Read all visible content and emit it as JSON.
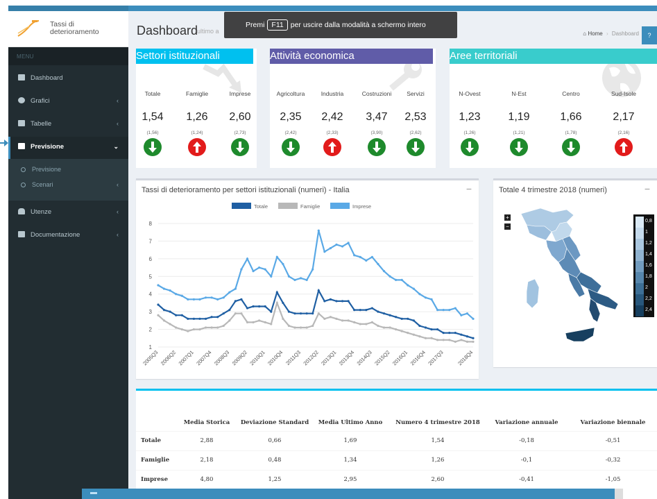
{
  "app": {
    "logo_text": "Tassi di deterioramento",
    "menu_header": "MENU"
  },
  "sidebar": {
    "items": [
      {
        "label": "Dashboard",
        "icon": "dashboard-icon"
      },
      {
        "label": "Grafici",
        "icon": "pie-chart-icon"
      },
      {
        "label": "Tabelle",
        "icon": "table-icon"
      },
      {
        "label": "Previsione",
        "icon": "bar-chart-icon"
      },
      {
        "label": "Utenze",
        "icon": "user-icon"
      },
      {
        "label": "Documentazione",
        "icon": "book-icon"
      }
    ],
    "sub_items": [
      {
        "label": "Previsione"
      },
      {
        "label": "Scenari"
      }
    ]
  },
  "header": {
    "title": "Dashboard",
    "subtitle": "ultimo a",
    "breadcrumb_home": "Home",
    "breadcrumb_current": "Dashboard",
    "help": "?"
  },
  "fullscreen_notice": {
    "before": "Premi",
    "key": "F11",
    "after": "per uscire dalla modalità a schermo intero"
  },
  "kpi_cards": [
    {
      "title": "Settori istituzionali",
      "color": "#00c0ef",
      "columns": [
        {
          "label": "Totale",
          "value": "1,54",
          "prev": "(1,56)",
          "trend": "down"
        },
        {
          "label": "Famiglie",
          "value": "1,26",
          "prev": "(1,24)",
          "trend": "up"
        },
        {
          "label": "Imprese",
          "value": "2,60",
          "prev": "(2,73)",
          "trend": "down"
        }
      ]
    },
    {
      "title": "Attività economica",
      "color": "#605ca8",
      "columns": [
        {
          "label": "Agricoltura",
          "value": "2,35",
          "prev": "(2,42)",
          "trend": "down"
        },
        {
          "label": "Industria",
          "value": "2,42",
          "prev": "(2,33)",
          "trend": "up"
        },
        {
          "label": "Costruzioni",
          "value": "3,47",
          "prev": "(3,90)",
          "trend": "down"
        },
        {
          "label": "Servizi",
          "value": "2,53",
          "prev": "(2,62)",
          "trend": "down"
        }
      ]
    },
    {
      "title": "Aree territoriali",
      "color": "#39cccc",
      "columns": [
        {
          "label": "N-Ovest",
          "value": "1,23",
          "prev": "(1,26)",
          "trend": "down"
        },
        {
          "label": "N-Est",
          "value": "1,19",
          "prev": "(1,21)",
          "trend": "down"
        },
        {
          "label": "Centro",
          "value": "1,66",
          "prev": "(1,78)",
          "trend": "down"
        },
        {
          "label": "Sud-Isole",
          "value": "2,17",
          "prev": "(2,16)",
          "trend": "up"
        }
      ]
    }
  ],
  "line_chart": {
    "title": "Tassi di deterioramento per settori istituzionali (numeri) - Italia",
    "collapse": "−"
  },
  "chart_data": {
    "type": "line",
    "x": [
      "2005Q3",
      "2005Q4",
      "2006Q1",
      "2006Q2",
      "2006Q3",
      "2006Q4",
      "2007Q1",
      "2007Q2",
      "2007Q3",
      "2007Q4",
      "2008Q1",
      "2008Q2",
      "2008Q3",
      "2008Q4",
      "2009Q1",
      "2009Q2",
      "2009Q3",
      "2009Q4",
      "2010Q1",
      "2010Q2",
      "2010Q3",
      "2010Q4",
      "2011Q1",
      "2011Q2",
      "2011Q3",
      "2011Q4",
      "2012Q1",
      "2012Q2",
      "2012Q3",
      "2012Q4",
      "2013Q1",
      "2013Q2",
      "2013Q3",
      "2013Q4",
      "2014Q1",
      "2014Q2",
      "2014Q3",
      "2014Q4",
      "2015Q1",
      "2015Q2",
      "2015Q3",
      "2015Q4",
      "2016Q1",
      "2016Q2",
      "2016Q3",
      "2016Q4",
      "2017Q1",
      "2017Q2",
      "2017Q3",
      "2017Q4",
      "2018Q1",
      "2018Q2",
      "2018Q3",
      "2018Q4"
    ],
    "x_ticks": [
      "2005Q3",
      "2006Q2",
      "2007Q1",
      "2007Q4",
      "2008Q3",
      "2009Q2",
      "2010Q1",
      "2010Q4",
      "2011Q3",
      "2012Q2",
      "2013Q1",
      "2013Q4",
      "2014Q3",
      "2015Q2",
      "2016Q1",
      "2016Q4",
      "2017Q3",
      "2018Q4"
    ],
    "series": [
      {
        "name": "Totale",
        "color": "#1f5fa3",
        "values": [
          3.4,
          3.1,
          3.0,
          2.8,
          2.8,
          2.6,
          2.6,
          2.6,
          2.6,
          2.7,
          2.7,
          2.9,
          3.1,
          3.6,
          3.7,
          3.2,
          3.3,
          3.3,
          3.3,
          3.0,
          4.1,
          3.5,
          3.0,
          2.9,
          2.9,
          2.9,
          2.9,
          4.2,
          3.6,
          3.7,
          3.6,
          3.6,
          3.6,
          3.1,
          3.1,
          3.1,
          3.2,
          3.0,
          2.9,
          2.8,
          2.7,
          2.6,
          2.6,
          2.5,
          2.2,
          2.1,
          2.0,
          2.0,
          1.8,
          1.8,
          1.8,
          1.7,
          1.6,
          1.5
        ]
      },
      {
        "name": "Famiglie",
        "color": "#b8b8b8",
        "values": [
          2.8,
          2.5,
          2.3,
          2.1,
          2.0,
          1.9,
          2.0,
          2.0,
          2.1,
          2.1,
          2.1,
          2.2,
          2.5,
          2.9,
          2.9,
          2.4,
          2.4,
          2.5,
          2.4,
          2.3,
          3.5,
          2.6,
          2.2,
          2.1,
          2.1,
          2.1,
          2.2,
          2.9,
          2.6,
          2.7,
          2.6,
          2.5,
          2.5,
          2.4,
          2.3,
          2.3,
          2.4,
          2.2,
          2.1,
          2.1,
          2.0,
          1.9,
          1.8,
          1.7,
          1.6,
          1.5,
          1.5,
          1.4,
          1.4,
          1.4,
          1.3,
          1.4,
          1.3,
          1.3
        ]
      },
      {
        "name": "Imprese",
        "color": "#5aa9e6",
        "values": [
          4.5,
          4.3,
          4.2,
          4.0,
          3.9,
          3.7,
          3.7,
          3.7,
          3.8,
          3.8,
          3.7,
          3.8,
          4.1,
          4.3,
          5.4,
          6.0,
          5.3,
          5.5,
          5.4,
          5.0,
          6.1,
          5.7,
          5.0,
          4.8,
          4.9,
          4.8,
          5.4,
          7.6,
          6.4,
          6.6,
          6.8,
          6.7,
          6.9,
          6.2,
          6.1,
          5.9,
          6.1,
          5.7,
          5.3,
          5.0,
          4.8,
          4.8,
          4.5,
          4.3,
          4.0,
          3.8,
          3.7,
          3.1,
          3.1,
          3.1,
          3.2,
          2.8,
          2.9,
          2.6
        ]
      }
    ],
    "ylim": [
      1,
      8
    ],
    "y_ticks": [
      1,
      2,
      3,
      4,
      5,
      6,
      7,
      8
    ],
    "legend_position": "top-center",
    "grid": true
  },
  "map_card": {
    "title": "Totale 4 trimestre 2018 (numeri)",
    "collapse": "−",
    "zoom_in": "+",
    "zoom_out": "−",
    "legend": [
      {
        "label": "0,8",
        "color": "#dbeaf6"
      },
      {
        "label": "1",
        "color": "#c6dbed"
      },
      {
        "label": "1,2",
        "color": "#abc8e0"
      },
      {
        "label": "1,4",
        "color": "#90b3d0"
      },
      {
        "label": "1,6",
        "color": "#729cbf"
      },
      {
        "label": "1,8",
        "color": "#5686ac"
      },
      {
        "label": "2",
        "color": "#3d6f96"
      },
      {
        "label": "2,2",
        "color": "#28577c"
      },
      {
        "label": "2,4",
        "color": "#173f5f"
      }
    ]
  },
  "stats_table": {
    "headers": [
      "",
      "Media Storica",
      "Deviazione Standard",
      "Media Ultimo Anno",
      "Numero 4 trimestre 2018",
      "Variazione annuale",
      "Variazione biennale"
    ],
    "rows": [
      [
        "Totale",
        "2,88",
        "0,66",
        "1,69",
        "1,54",
        "-0,18",
        "-0,51"
      ],
      [
        "Famiglie",
        "2,18",
        "0,48",
        "1,34",
        "1,26",
        "-0,1",
        "-0,32"
      ],
      [
        "Imprese",
        "4,80",
        "1,25",
        "2,95",
        "2,60",
        "-0,41",
        "-1,05"
      ]
    ]
  }
}
